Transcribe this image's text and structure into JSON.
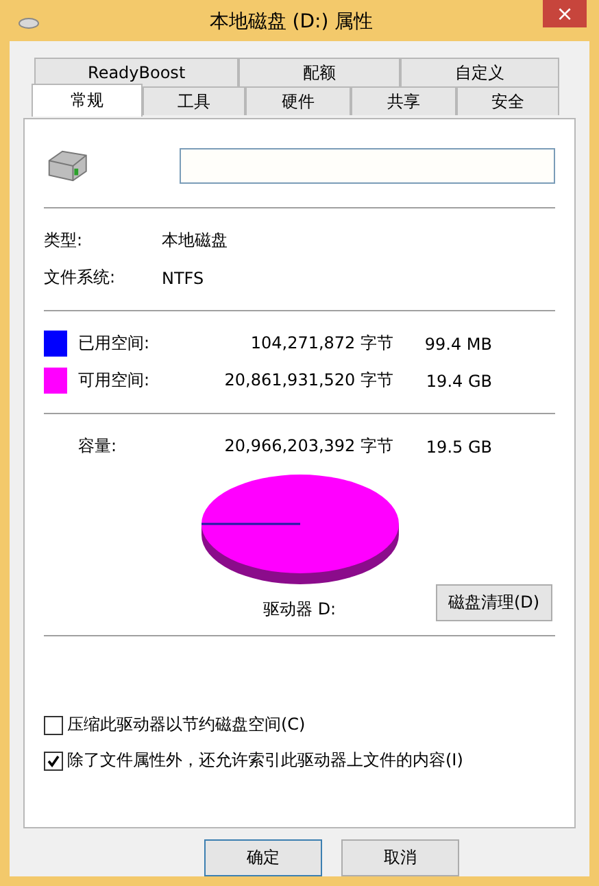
{
  "window": {
    "title": "本地磁盘 (D:) 属性",
    "close": "×"
  },
  "tabs_back": [
    {
      "label": "ReadyBoost",
      "selected": false
    },
    {
      "label": "配额",
      "selected": false
    },
    {
      "label": "自定义",
      "selected": false
    }
  ],
  "tabs_front": [
    {
      "label": "常规",
      "selected": true
    },
    {
      "label": "工具",
      "selected": false
    },
    {
      "label": "硬件",
      "selected": false
    },
    {
      "label": "共享",
      "selected": false
    },
    {
      "label": "安全",
      "selected": false
    }
  ],
  "info": [
    {
      "label": "类型:",
      "value": "本地磁盘"
    },
    {
      "label": "文件系统:",
      "value": "NTFS"
    }
  ],
  "space": [
    {
      "label": "已用空间:",
      "bytes": "104,271,872 字节",
      "size": "99.4 MB",
      "color": "#0000ff"
    },
    {
      "label": "可用空间:",
      "bytes": "20,861,931,520 字节",
      "size": "19.4 GB",
      "color": "#ff00ff"
    }
  ],
  "capacity": {
    "label": "容量:",
    "bytes": "20,966,203,392 字节",
    "size": "19.5 GB"
  },
  "drive_label": "驱动器 D:",
  "cleanup_button": "磁盘清理(D)",
  "options": [
    {
      "label": "压缩此驱动器以节约磁盘空间(C)",
      "checked": false
    },
    {
      "label": "除了文件属性外，还允许索引此驱动器上文件的内容(I)",
      "checked": true
    }
  ],
  "buttons": [
    {
      "label": "确定",
      "selected": true
    },
    {
      "label": "取消",
      "selected": false
    }
  ]
}
